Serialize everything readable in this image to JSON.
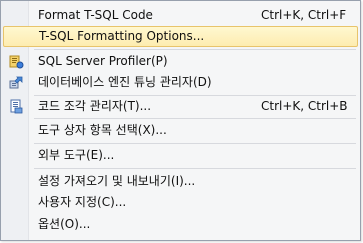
{
  "menu": {
    "items": [
      {
        "label": "Format T-SQL Code",
        "shortcut": "Ctrl+K, Ctrl+F"
      },
      {
        "label": "T-SQL Formatting Options..."
      },
      {
        "label": "SQL Server Profiler(P)",
        "icon": "profiler-icon"
      },
      {
        "label": "데이터베이스 엔진 튜닝 관리자(D)",
        "icon": "tuning-advisor-icon"
      },
      {
        "label": "코드 조각 관리자(T)...",
        "shortcut": "Ctrl+K, Ctrl+B",
        "icon": "snippets-icon"
      },
      {
        "label": "도구 상자 항목 선택(X)..."
      },
      {
        "label": "외부 도구(E)..."
      },
      {
        "label": "설정 가져오기 및 내보내기(I)..."
      },
      {
        "label": "사용자 지정(C)..."
      },
      {
        "label": "옵션(O)..."
      }
    ],
    "highlighted_index": 1
  },
  "colors": {
    "highlight": "#fdecb0",
    "highlight_border": "#e8c46b",
    "menu_bg": "#f5f6f7"
  }
}
